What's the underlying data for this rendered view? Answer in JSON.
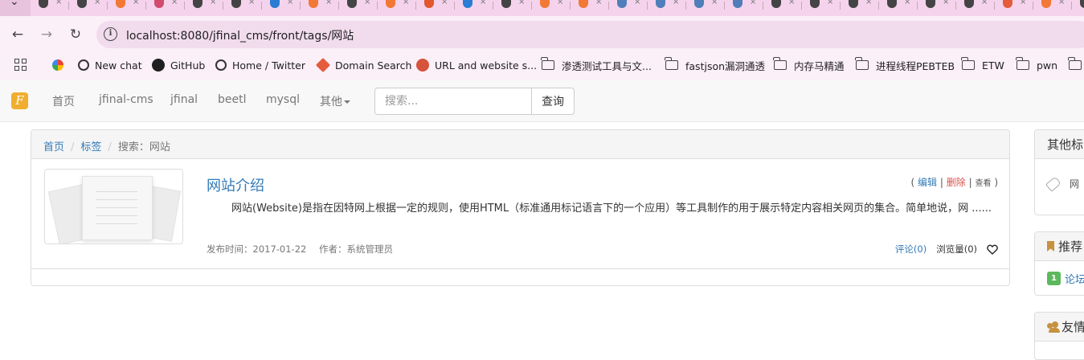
{
  "browser": {
    "url": "localhost:8080/jfinal_cms/front/tags/网站",
    "tab_favicon_colors": [
      "#444444",
      "#444444",
      "#f27935",
      "#d04b6d",
      "#444444",
      "#444444",
      "#2b7cd3",
      "#f27935",
      "#444444",
      "#f27935",
      "#e2572d",
      "#2b7cd3",
      "#444444",
      "#f27935",
      "#f27935",
      "#4f7eb8",
      "#4f7eb8",
      "#4f7eb8",
      "#4f7eb8",
      "#444444",
      "#444444",
      "#444444",
      "#444444",
      "#444444",
      "#444444",
      "#e55c3c",
      "#f27935",
      "#444444",
      "#444444"
    ],
    "bookmarks": [
      {
        "label": "",
        "icon": "google-icon",
        "color": "#ea4335"
      },
      {
        "label": "New chat",
        "icon": "chatgpt-icon",
        "color": "#333333"
      },
      {
        "label": "GitHub",
        "icon": "github-icon",
        "color": "#1f1f1f"
      },
      {
        "label": "Home / Twitter",
        "icon": "globe-icon",
        "color": "#333333"
      },
      {
        "label": "Domain Search",
        "icon": "domain-search-icon",
        "color": "#e55c3c"
      },
      {
        "label": "URL and website s...",
        "icon": "url-scan-icon",
        "color": "#d6533c"
      },
      {
        "label": "渗透测试工具与文...",
        "icon": "folder-icon",
        "color": "#444444"
      },
      {
        "label": "fastjson漏洞通透",
        "icon": "folder-icon",
        "color": "#444444"
      },
      {
        "label": "内存马精通",
        "icon": "folder-icon",
        "color": "#444444"
      },
      {
        "label": "进程线程PEBTEB",
        "icon": "folder-icon",
        "color": "#444444"
      },
      {
        "label": "ETW",
        "icon": "folder-icon",
        "color": "#444444"
      },
      {
        "label": "pwn",
        "icon": "folder-icon",
        "color": "#444444"
      },
      {
        "label": "",
        "icon": "folder-icon",
        "color": "#444444"
      }
    ]
  },
  "navbar": {
    "brand": "F",
    "links": [
      "首页",
      "jfinal-cms",
      "jfinal",
      "beetl",
      "mysql",
      "其他"
    ],
    "search_placeholder": "搜索...",
    "search_button": "查询"
  },
  "breadcrumb": {
    "home": "首页",
    "tags": "标签",
    "current": "搜索：网站"
  },
  "article": {
    "title": "网站介绍",
    "actions": {
      "open": "(",
      "edit": "编辑",
      "sep": "|",
      "delete": "删除",
      "view": "查看",
      "close": ")"
    },
    "summary": "网站(Website)是指在因特网上根据一定的规则，使用HTML（标准通用标记语言下的一个应用）等工具制作的用于展示特定内容相关网页的集合。简单地说，网 ......",
    "publish_time": "发布时间：2017-01-22",
    "author": "作者：系统管理员",
    "comments": "评论(0)",
    "views": "浏览量(0)"
  },
  "sidebar": {
    "other_tags_title": "其他标",
    "other_tag": "网",
    "recommend_title": "推荐",
    "recommend_rank": "1",
    "recommend_item": "论坛",
    "friends_title": "友情"
  },
  "colors": {
    "link": "#337ab7",
    "danger": "#d9534f",
    "badge_green": "#5cb85c",
    "brand_orange": "#f0ad2e",
    "sidebar_icon": "#c7923e"
  }
}
